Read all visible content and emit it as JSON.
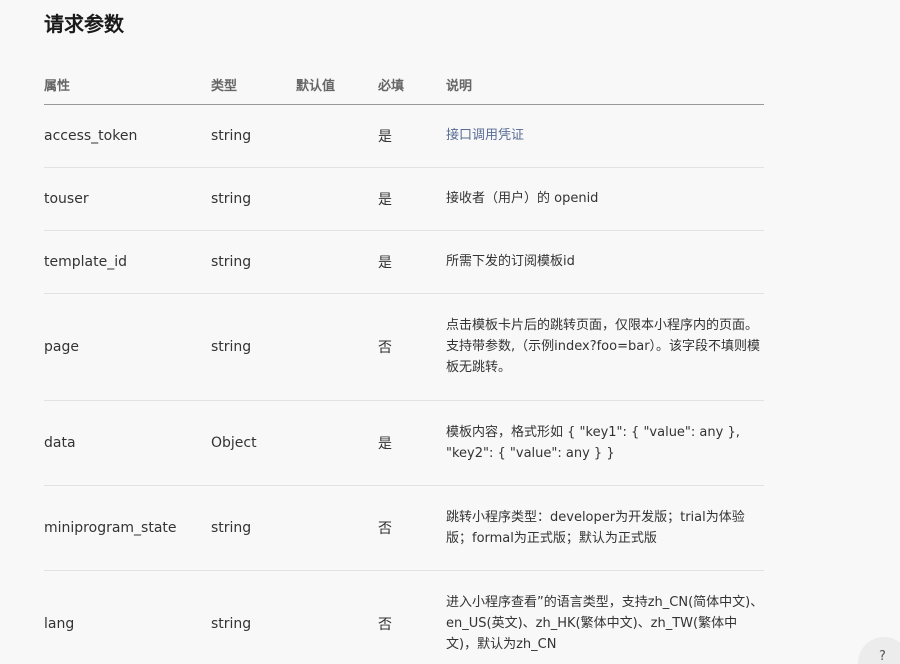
{
  "title": "请求参数",
  "headers": {
    "name": "属性",
    "type": "类型",
    "default": "默认值",
    "required": "必填",
    "description": "说明"
  },
  "rows": [
    {
      "name": "access_token",
      "type": "string",
      "default": "",
      "required": "是",
      "description": "接口调用凭证",
      "link": true
    },
    {
      "name": "touser",
      "type": "string",
      "default": "",
      "required": "是",
      "description": "接收者（用户）的 openid"
    },
    {
      "name": "template_id",
      "type": "string",
      "default": "",
      "required": "是",
      "description": "所需下发的订阅模板id"
    },
    {
      "name": "page",
      "type": "string",
      "default": "",
      "required": "否",
      "description": "点击模板卡片后的跳转页面，仅限本小程序内的页面。支持带参数,（示例index?foo=bar）。该字段不填则模板无跳转。"
    },
    {
      "name": "data",
      "type": "Object",
      "default": "",
      "required": "是",
      "description": "模板内容，格式形如 { \"key1\": { \"value\": any }, \"key2\": { \"value\": any } }"
    },
    {
      "name": "miniprogram_state",
      "type": "string",
      "default": "",
      "required": "否",
      "description": "跳转小程序类型：developer为开发版；trial为体验版；formal为正式版；默认为正式版"
    },
    {
      "name": "lang",
      "type": "string",
      "default": "",
      "required": "否",
      "description": "进入小程序查看”的语言类型，支持zh_CN(简体中文)、en_US(英文)、zh_HK(繁体中文)、zh_TW(繁体中文)，默认为zh_CN"
    }
  ],
  "help_button": "?"
}
